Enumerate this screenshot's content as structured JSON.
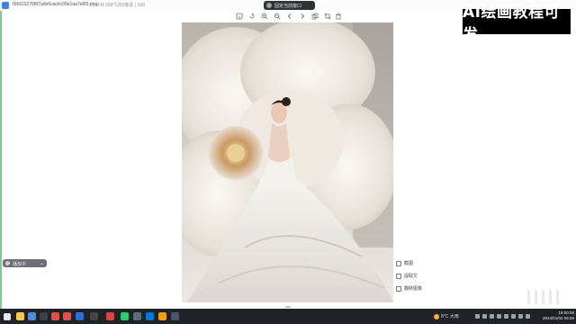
{
  "window": {
    "file_name": "7b5615276f97ade6cacbc99e1aa7e8f3.png",
    "file_meta": "| 8FM  958*1280像素 | 100",
    "center_title": "固定当前窗口"
  },
  "toolbar": {
    "buttons": [
      {
        "icon": "info-icon"
      },
      {
        "icon": "rotate-icon"
      },
      {
        "icon": "zoom-in-icon"
      },
      {
        "icon": "zoom-out-icon"
      },
      {
        "icon": "prev-icon"
      },
      {
        "icon": "next-icon"
      },
      {
        "icon": "copy-icon"
      },
      {
        "icon": "crop-icon"
      },
      {
        "icon": "delete-icon"
      }
    ]
  },
  "watermark": {
    "text": "AI绘画教程可发"
  },
  "left_control": {
    "label": "播放中"
  },
  "actions": [
    {
      "label": "截图",
      "icon": "screenshot-icon"
    },
    {
      "label": "提取文",
      "icon": "text-extract-icon"
    },
    {
      "label": "翻转图像",
      "icon": "flip-icon"
    }
  ],
  "taskbar": {
    "weather": "8°C 大雨",
    "time": "19:00:08",
    "date": "2024/01/02 06:58"
  },
  "colors": {
    "titlebar_bg": "#fbfbfb",
    "taskbar_bg": "#1f2328",
    "accent": "#3b82f6"
  }
}
